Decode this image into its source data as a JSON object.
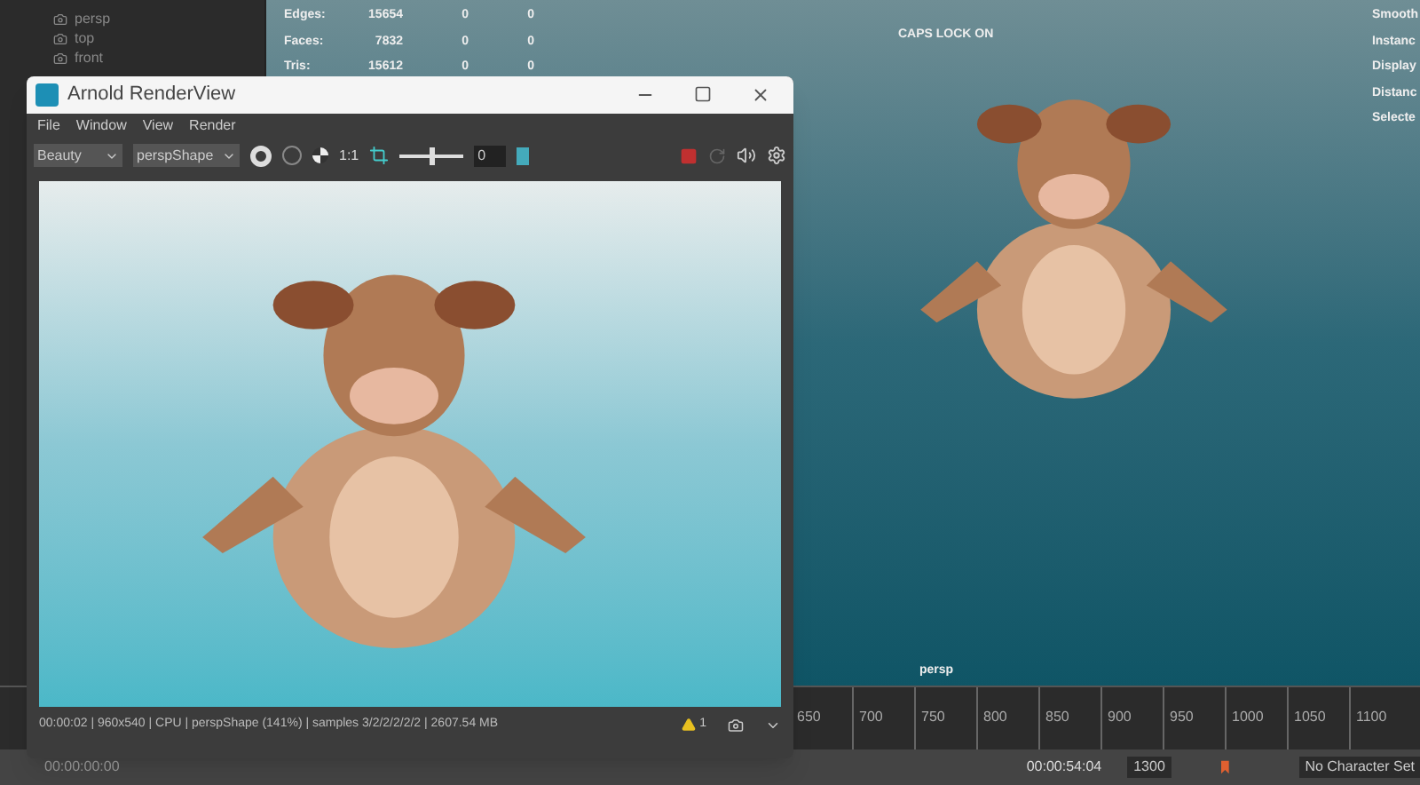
{
  "outliner": {
    "items": [
      {
        "label": "persp"
      },
      {
        "label": "top"
      },
      {
        "label": "front"
      }
    ]
  },
  "viewport": {
    "stats": [
      {
        "label": "Edges:",
        "values": [
          "15654",
          "0",
          "0"
        ]
      },
      {
        "label": "Faces:",
        "values": [
          "7832",
          "0",
          "0"
        ]
      },
      {
        "label": "Tris:",
        "values": [
          "15612",
          "0",
          "0"
        ]
      }
    ],
    "caps_lock": "CAPS LOCK ON",
    "hud_right": [
      "Smooth",
      "Instanc",
      "Display",
      "Distanc",
      "Selecte"
    ],
    "camera_label": "persp"
  },
  "render_view": {
    "title": "Arnold RenderView",
    "menu": [
      "File",
      "Window",
      "View",
      "Render"
    ],
    "aov": "Beauty",
    "camera": "perspShape",
    "ratio": "1:1",
    "exposure": "0",
    "exposure_slider": {
      "level": 0.5
    },
    "status": "00:00:02 | 960x540 | CPU | perspShape (141%) | samples 3/2/2/2/2/2 | 2607.54 MB",
    "warnings": "1"
  },
  "timeline": {
    "ticks": [
      "650",
      "700",
      "750",
      "800",
      "850",
      "900",
      "950",
      "1000",
      "1050",
      "1100"
    ]
  },
  "bottom_bar": {
    "start_time": "00:00:00:00",
    "current_time": "00:00:54:04",
    "end_frame": "1300",
    "character_set": "No Character Set"
  }
}
